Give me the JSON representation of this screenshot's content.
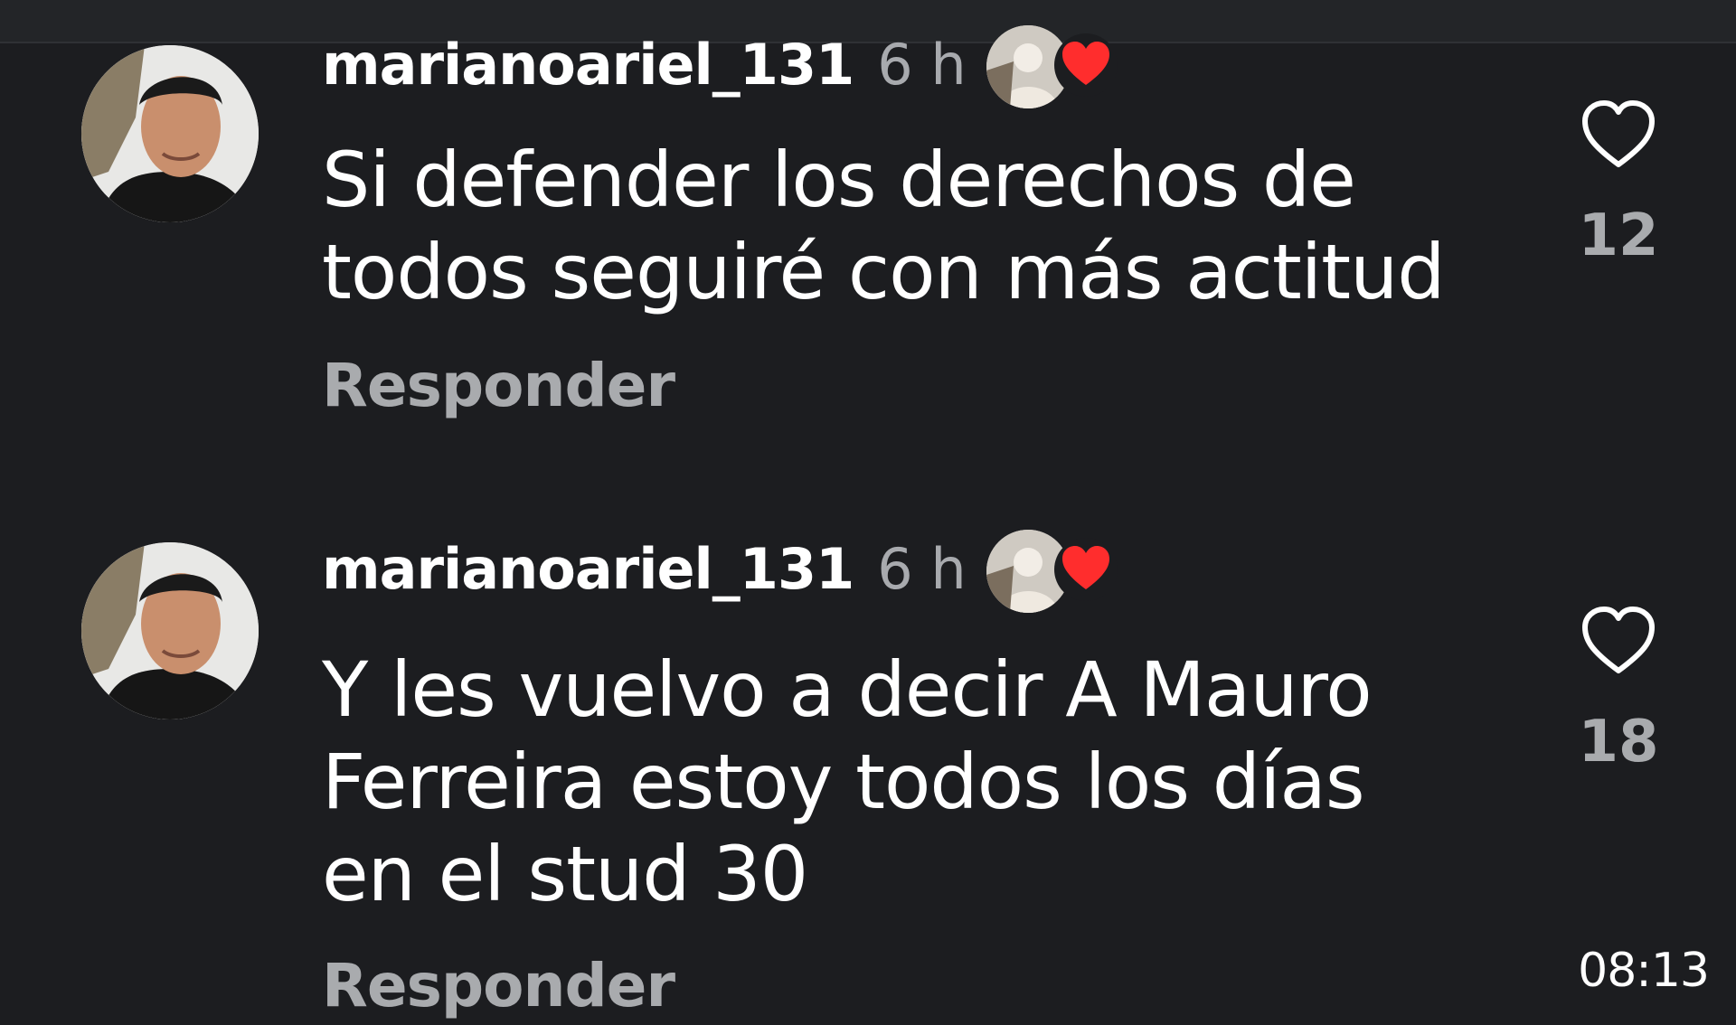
{
  "comments": [
    {
      "username": "marianoariel_131",
      "time": "6 h",
      "text_lines": [
        "Si defender los derechos de",
        "todos seguiré con más actitud"
      ],
      "reply_label": "Responder",
      "like_count": "12",
      "liked_by_author": true
    },
    {
      "username": "marianoariel_131",
      "time": "6 h",
      "text_lines": [
        "Y les vuelvo a decir A Mauro",
        "Ferreira estoy todos los días",
        "en el stud 30"
      ],
      "reply_label": "Responder",
      "like_count": "18",
      "liked_by_author": true
    }
  ],
  "video_timestamp": "08:13",
  "icons": {
    "like": "heart-outline-icon",
    "author_like_badge": "heart-filled-icon"
  },
  "colors": {
    "background": "#1c1d20",
    "heart_badge": "#ff2d2d",
    "secondary_text": "#a9abae"
  }
}
